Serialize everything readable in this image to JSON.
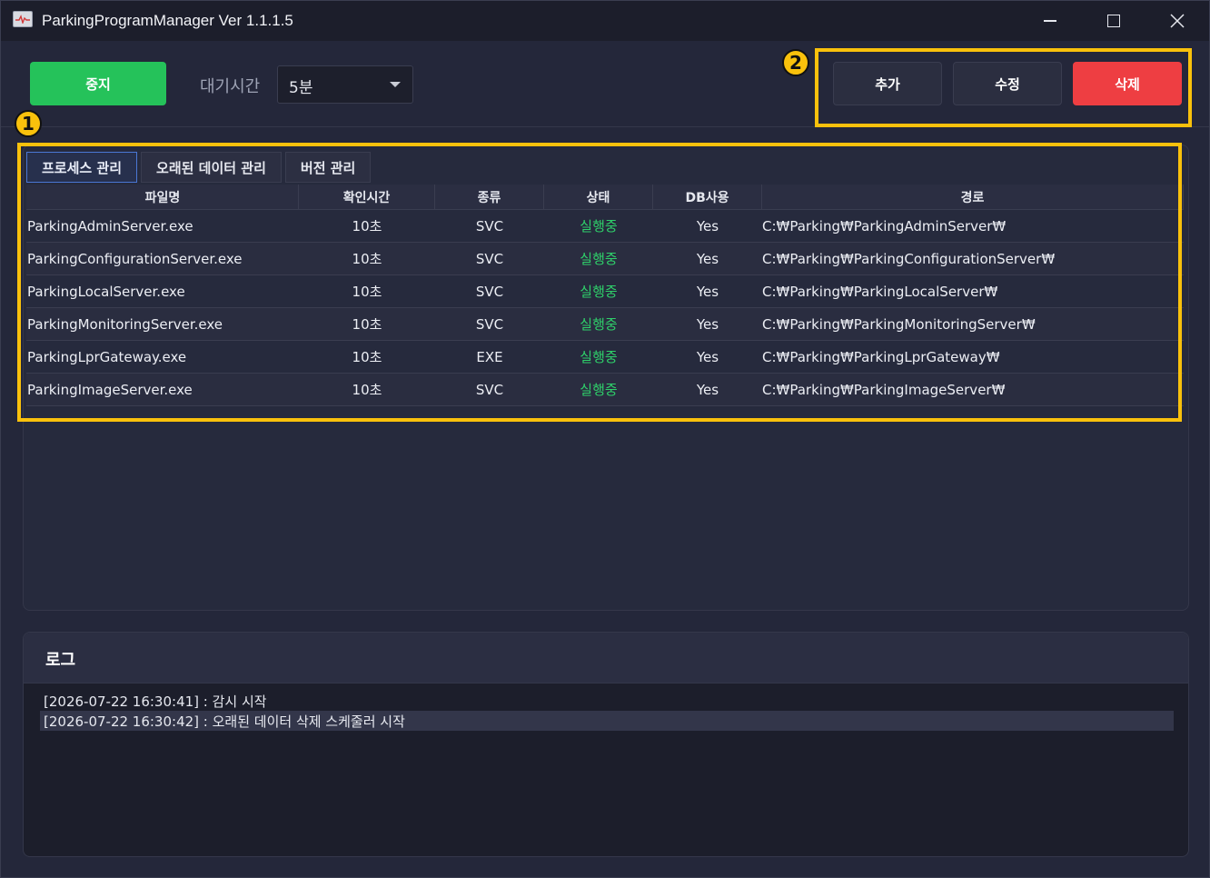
{
  "window": {
    "title": "ParkingProgramManager Ver 1.1.1.5",
    "icons": {
      "app": "monitor-pulse-icon",
      "minimize": "minimize-icon",
      "maximize": "maximize-icon",
      "close": "close-icon"
    }
  },
  "toolbar": {
    "stop_label": "중지",
    "wait_label": "대기시간",
    "wait_value": "5분",
    "add_label": "추가",
    "edit_label": "수정",
    "delete_label": "삭제"
  },
  "annotations": {
    "badge1": "1",
    "badge2": "2"
  },
  "tabs": [
    {
      "label": "프로세스 관리",
      "active": true
    },
    {
      "label": "오래된 데이터 관리",
      "active": false
    },
    {
      "label": "버전 관리",
      "active": false
    }
  ],
  "table": {
    "columns": [
      "파일명",
      "확인시간",
      "종류",
      "상태",
      "DB사용",
      "경로"
    ],
    "rows": [
      [
        "ParkingAdminServer.exe",
        "10초",
        "SVC",
        "실행중",
        "Yes",
        "C:₩Parking₩ParkingAdminServer₩"
      ],
      [
        "ParkingConfigurationServer.exe",
        "10초",
        "SVC",
        "실행중",
        "Yes",
        "C:₩Parking₩ParkingConfigurationServer₩"
      ],
      [
        "ParkingLocalServer.exe",
        "10초",
        "SVC",
        "실행중",
        "Yes",
        "C:₩Parking₩ParkingLocalServer₩"
      ],
      [
        "ParkingMonitoringServer.exe",
        "10초",
        "SVC",
        "실행중",
        "Yes",
        "C:₩Parking₩ParkingMonitoringServer₩"
      ],
      [
        "ParkingLprGateway.exe",
        "10초",
        "EXE",
        "실행중",
        "Yes",
        "C:₩Parking₩ParkingLprGateway₩"
      ],
      [
        "ParkingImageServer.exe",
        "10초",
        "SVC",
        "실행중",
        "Yes",
        "C:₩Parking₩ParkingImageServer₩"
      ]
    ]
  },
  "log": {
    "title": "로그",
    "lines": [
      "[2026-07-22 16:30:41] : 감시 시작",
      "[2026-07-22 16:30:42] : 오래된 데이터 삭제 스케줄러 시작"
    ]
  },
  "colors": {
    "accent_green": "#25c25a",
    "danger_red": "#ee3e42",
    "highlight_yellow": "#f9c10c",
    "status_running": "#2fd06a"
  }
}
